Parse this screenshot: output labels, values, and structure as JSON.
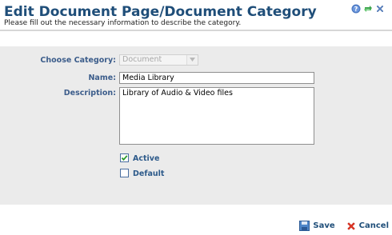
{
  "header": {
    "title": "Edit Document Page/Document Category",
    "subtitle": "Please fill out the necessary information to describe the category.",
    "icons": [
      "help-icon",
      "refresh-icon",
      "close-icon"
    ]
  },
  "form": {
    "category": {
      "label": "Choose Category:",
      "value": "Document"
    },
    "name": {
      "label": "Name:",
      "value": "Media Library"
    },
    "description": {
      "label": "Description:",
      "value": "Library of Audio & Video files"
    },
    "active": {
      "label": "Active",
      "checked": true
    },
    "default": {
      "label": "Default",
      "checked": false
    }
  },
  "footer": {
    "save_label": "Save",
    "cancel_label": "Cancel"
  },
  "colors": {
    "title": "#1f4e79",
    "label": "#3c5d8b",
    "panel_bg": "#ebebeb",
    "cancel_icon": "#e03a2a"
  }
}
